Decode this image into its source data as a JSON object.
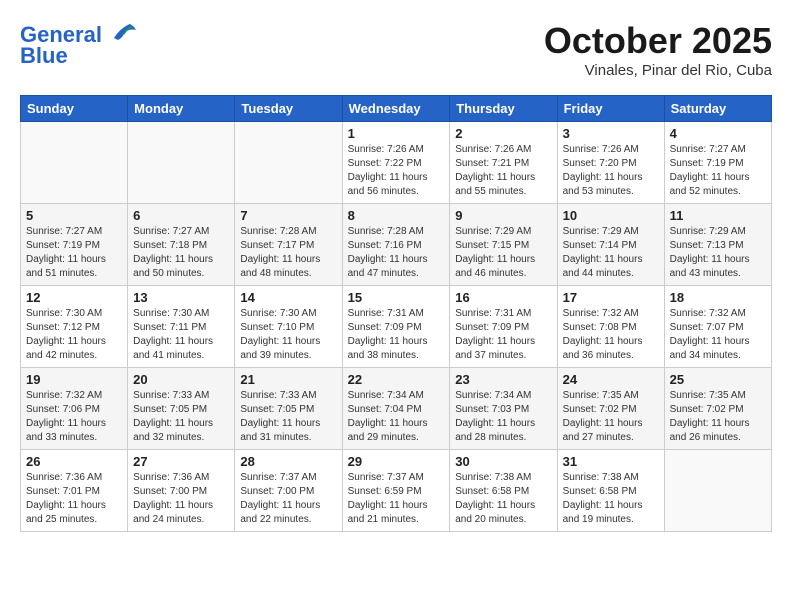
{
  "header": {
    "logo_line1": "General",
    "logo_line2": "Blue",
    "month": "October 2025",
    "location": "Vinales, Pinar del Rio, Cuba"
  },
  "weekdays": [
    "Sunday",
    "Monday",
    "Tuesday",
    "Wednesday",
    "Thursday",
    "Friday",
    "Saturday"
  ],
  "weeks": [
    [
      {
        "date": "",
        "info": ""
      },
      {
        "date": "",
        "info": ""
      },
      {
        "date": "",
        "info": ""
      },
      {
        "date": "1",
        "info": "Sunrise: 7:26 AM\nSunset: 7:22 PM\nDaylight: 11 hours and 56 minutes."
      },
      {
        "date": "2",
        "info": "Sunrise: 7:26 AM\nSunset: 7:21 PM\nDaylight: 11 hours and 55 minutes."
      },
      {
        "date": "3",
        "info": "Sunrise: 7:26 AM\nSunset: 7:20 PM\nDaylight: 11 hours and 53 minutes."
      },
      {
        "date": "4",
        "info": "Sunrise: 7:27 AM\nSunset: 7:19 PM\nDaylight: 11 hours and 52 minutes."
      }
    ],
    [
      {
        "date": "5",
        "info": "Sunrise: 7:27 AM\nSunset: 7:19 PM\nDaylight: 11 hours and 51 minutes."
      },
      {
        "date": "6",
        "info": "Sunrise: 7:27 AM\nSunset: 7:18 PM\nDaylight: 11 hours and 50 minutes."
      },
      {
        "date": "7",
        "info": "Sunrise: 7:28 AM\nSunset: 7:17 PM\nDaylight: 11 hours and 48 minutes."
      },
      {
        "date": "8",
        "info": "Sunrise: 7:28 AM\nSunset: 7:16 PM\nDaylight: 11 hours and 47 minutes."
      },
      {
        "date": "9",
        "info": "Sunrise: 7:29 AM\nSunset: 7:15 PM\nDaylight: 11 hours and 46 minutes."
      },
      {
        "date": "10",
        "info": "Sunrise: 7:29 AM\nSunset: 7:14 PM\nDaylight: 11 hours and 44 minutes."
      },
      {
        "date": "11",
        "info": "Sunrise: 7:29 AM\nSunset: 7:13 PM\nDaylight: 11 hours and 43 minutes."
      }
    ],
    [
      {
        "date": "12",
        "info": "Sunrise: 7:30 AM\nSunset: 7:12 PM\nDaylight: 11 hours and 42 minutes."
      },
      {
        "date": "13",
        "info": "Sunrise: 7:30 AM\nSunset: 7:11 PM\nDaylight: 11 hours and 41 minutes."
      },
      {
        "date": "14",
        "info": "Sunrise: 7:30 AM\nSunset: 7:10 PM\nDaylight: 11 hours and 39 minutes."
      },
      {
        "date": "15",
        "info": "Sunrise: 7:31 AM\nSunset: 7:09 PM\nDaylight: 11 hours and 38 minutes."
      },
      {
        "date": "16",
        "info": "Sunrise: 7:31 AM\nSunset: 7:09 PM\nDaylight: 11 hours and 37 minutes."
      },
      {
        "date": "17",
        "info": "Sunrise: 7:32 AM\nSunset: 7:08 PM\nDaylight: 11 hours and 36 minutes."
      },
      {
        "date": "18",
        "info": "Sunrise: 7:32 AM\nSunset: 7:07 PM\nDaylight: 11 hours and 34 minutes."
      }
    ],
    [
      {
        "date": "19",
        "info": "Sunrise: 7:32 AM\nSunset: 7:06 PM\nDaylight: 11 hours and 33 minutes."
      },
      {
        "date": "20",
        "info": "Sunrise: 7:33 AM\nSunset: 7:05 PM\nDaylight: 11 hours and 32 minutes."
      },
      {
        "date": "21",
        "info": "Sunrise: 7:33 AM\nSunset: 7:05 PM\nDaylight: 11 hours and 31 minutes."
      },
      {
        "date": "22",
        "info": "Sunrise: 7:34 AM\nSunset: 7:04 PM\nDaylight: 11 hours and 29 minutes."
      },
      {
        "date": "23",
        "info": "Sunrise: 7:34 AM\nSunset: 7:03 PM\nDaylight: 11 hours and 28 minutes."
      },
      {
        "date": "24",
        "info": "Sunrise: 7:35 AM\nSunset: 7:02 PM\nDaylight: 11 hours and 27 minutes."
      },
      {
        "date": "25",
        "info": "Sunrise: 7:35 AM\nSunset: 7:02 PM\nDaylight: 11 hours and 26 minutes."
      }
    ],
    [
      {
        "date": "26",
        "info": "Sunrise: 7:36 AM\nSunset: 7:01 PM\nDaylight: 11 hours and 25 minutes."
      },
      {
        "date": "27",
        "info": "Sunrise: 7:36 AM\nSunset: 7:00 PM\nDaylight: 11 hours and 24 minutes."
      },
      {
        "date": "28",
        "info": "Sunrise: 7:37 AM\nSunset: 7:00 PM\nDaylight: 11 hours and 22 minutes."
      },
      {
        "date": "29",
        "info": "Sunrise: 7:37 AM\nSunset: 6:59 PM\nDaylight: 11 hours and 21 minutes."
      },
      {
        "date": "30",
        "info": "Sunrise: 7:38 AM\nSunset: 6:58 PM\nDaylight: 11 hours and 20 minutes."
      },
      {
        "date": "31",
        "info": "Sunrise: 7:38 AM\nSunset: 6:58 PM\nDaylight: 11 hours and 19 minutes."
      },
      {
        "date": "",
        "info": ""
      }
    ]
  ]
}
